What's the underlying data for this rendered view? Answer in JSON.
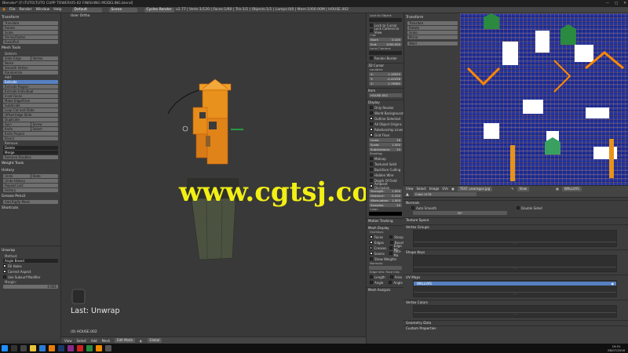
{
  "window": {
    "title": "Blender* [F:\\TUTO\\TUTO CUPP TOWER\\05-02 FINISHING MODELING.blend]"
  },
  "menubar": {
    "items": [
      "File",
      "Render",
      "Window",
      "Help"
    ],
    "layout": "Default",
    "scene": "Scene",
    "engine": "Cycles Render",
    "stats": "v2.77 | Verts:1/120 | Faces:1/60 | Tris:1/1 | Objects:1/1 | Lamps:0/0 | Mem:1000.00M | HOUSE.002"
  },
  "toolshelf": {
    "transform_header": "Transform",
    "transform_buttons": [
      "Translate",
      "Rotate",
      "Scale",
      "Shrink/Fatten",
      "Push/Pull"
    ],
    "mesh_tools_header": "Mesh Tools",
    "deform_label": "Deform:",
    "deform_buttons": [
      "Slide Edge",
      "Vertex",
      "Noise",
      "Smooth Vertex",
      "Randomize"
    ],
    "add_label": "Add:",
    "add_buttons": [
      "Extrude",
      "Extrude Region",
      "Extrude Individual",
      "Inset Faces",
      "Make Edge/Face",
      "Subdivide",
      "Loop Cut and Slide",
      "Offset Edge Slide",
      "Duplicate",
      "Spin",
      "Screw",
      "Knife",
      "Select",
      "Knife Project",
      "Bisect"
    ],
    "remove_label": "Remove:",
    "delete_label": "Delete",
    "merge_label": "Merge",
    "remove_doubles": "Remove Doubles",
    "weight_tools": "Weight Tools",
    "history_header": "History",
    "history_buttons": [
      "Undo",
      "Redo",
      "Undo History",
      "Repeat Last",
      "History"
    ],
    "grease_pencil": "Grease Pencil",
    "add_rigify": "Add Rigify Mesh",
    "shortcuts": "Shortcuts"
  },
  "lastop": {
    "header": "Unwrap",
    "method_label": "Method:",
    "method_value": "Angle Based",
    "fill_holes": "Fill Holes",
    "correct_aspect": "Correct Aspect",
    "subsurf": "Use Subsurf Modifier",
    "margin_label": "Margin:",
    "margin_value": "0.001"
  },
  "viewport": {
    "label": "User Ortho",
    "last_operator": "Last: Unwrap",
    "watermark": "www.cgtsj.com",
    "object_name": "(0) HOUSE.002"
  },
  "viewport_header": {
    "items": [
      "View",
      "Select",
      "Add",
      "Mesh"
    ],
    "mode": "Edit Mode",
    "pivot": "Global"
  },
  "properties": {
    "lock_header": "Lock to Object:",
    "lock_cursor": "Lock to Cursor",
    "lock_camera": "Lock Camera to View",
    "clip_label": "Clip:",
    "clip_start_label": "Start:",
    "clip_start_value": "0.100",
    "clip_end_label": "End:",
    "clip_end_value": "1000.000",
    "local_camera": "Local Camera:",
    "render_border": "Render Border",
    "cursor_header": "3D Cursor",
    "location_label": "Location:",
    "x_label": "X:",
    "x_value": "1.16550",
    "y_label": "Y:",
    "y_value": "-0.42036",
    "z_label": "Z:",
    "z_value": "2.78580",
    "item_header": "Item",
    "item_name": "HOUSE.002",
    "display_header": "Display",
    "only_render": "Only Render",
    "world_bg": "World Background",
    "outline_selected": "Outline Selected",
    "all_origins": "All Object Origins",
    "relationship": "Relationship Lines",
    "grid_floor": "Grid Floor",
    "lines_label": "Lines:",
    "lines_value": "16",
    "scale_label": "Scale:",
    "scale_value": "1.000",
    "subdiv_label": "Subdivisions:",
    "subdiv_value": "10",
    "shading": "Shading:",
    "matcap": "Matcap",
    "textured_solid": "Textured Solid",
    "backface": "Backface Culling",
    "hidden_wire": "Hidden Wire",
    "dof": "Depth Of Field",
    "ambient": "Ambient Occlusion",
    "strength_label": "Strength:",
    "strength_value": "1.000",
    "distance_label": "Distance:",
    "distance_value": "0.200",
    "attenuation_label": "Attenuation:",
    "attenuation_value": "1.000",
    "samples_label": "Samples:",
    "samples_value": "20",
    "color_label": "Color:",
    "motion_tracking": "Motion Tracking",
    "mesh_display": "Mesh Display",
    "overlays": "Overlays:",
    "faces": "Faces",
    "sharp": "Sharp",
    "edges": "Edges",
    "bevel": "Bevel",
    "creases": "Creases",
    "edge_ms": "Edge Ma",
    "seams": "Seams",
    "face_ma": "Face Ma",
    "show_weights": "Show Weights",
    "normals": "Normals:",
    "edge_info": "Edge Info:",
    "face_info": "Face Info:",
    "length": "Length",
    "area": "Area",
    "angle": "Angle",
    "angle2": "Angle",
    "mesh_analysis": "Mesh Analysis"
  },
  "uv_tools": {
    "header": "Transform",
    "buttons": [
      "Translate",
      "Rotate",
      "Scale",
      "Mirror"
    ],
    "weld": "Weld"
  },
  "uv_header": {
    "items": [
      "View",
      "Select",
      "Image",
      "UVs"
    ],
    "image": "TEST unwrapps.jpg",
    "view": "View",
    "uvmap": "WALLUVS"
  },
  "mesh_panel": {
    "object": "Cube.1478",
    "normals_header": "Normals",
    "auto_smooth": "Auto Smooth",
    "double_sided": "Double Sided",
    "angle_value": "30°",
    "texture_space": "Texture Space",
    "vertex_groups": "Vertex Groups",
    "shape_keys": "Shape Keys",
    "uv_maps": "UV Maps",
    "uv_map_item": "WALLUVS",
    "vertex_colors": "Vertex Colors",
    "geometry_data": "Geometry Data",
    "custom_props": "Custom Properties"
  },
  "taskbar": {
    "time": "19:51",
    "date": "06/07/2016"
  }
}
